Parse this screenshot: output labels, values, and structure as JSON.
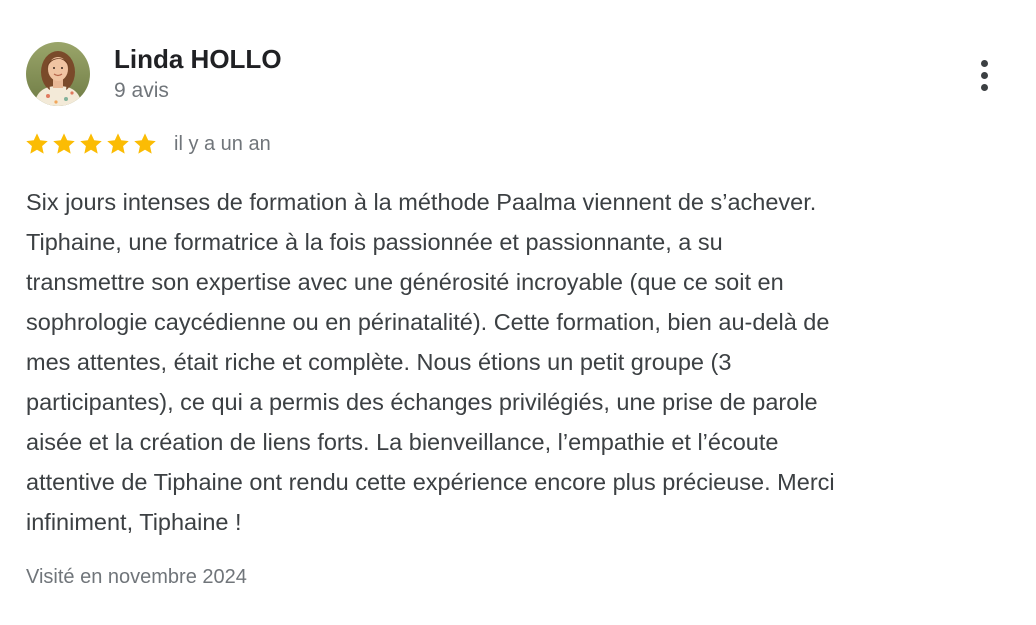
{
  "review": {
    "author": {
      "name": "Linda HOLLO",
      "meta": "9 avis",
      "avatar_icon": "user-photo-avatar"
    },
    "rating": {
      "stars": 5,
      "max": 5,
      "star_color": "#fbbc04",
      "date": "il y a un an"
    },
    "text_lines": [
      "Six jours intenses de formation à la méthode Paalma viennent de s’achever.",
      "Tiphaine, une formatrice à la fois passionnée et passionnante, a su",
      "transmettre son expertise avec une générosité incroyable (que ce soit en",
      "sophrologie caycédienne ou en périnatalité). Cette formation, bien au-delà de",
      "mes attentes, était riche et complète. Nous étions un petit groupe (3",
      "participantes), ce qui a permis des échanges privilégiés, une prise de parole",
      "aisée et la création de liens forts. La bienveillance, l’empathie et l’écoute",
      "attentive de Tiphaine ont rendu cette expérience encore plus précieuse. Merci",
      "infiniment, Tiphaine !"
    ],
    "visit": "Visité en novembre 2024",
    "more_icon": "more-vert-icon"
  }
}
